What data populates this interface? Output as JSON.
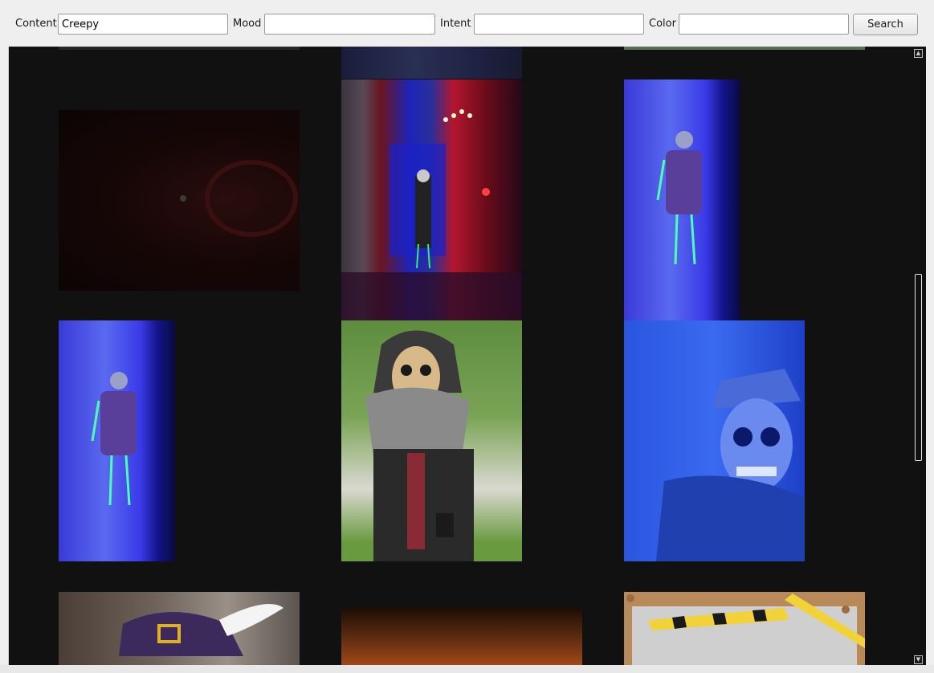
{
  "filters": {
    "content_label": "Content",
    "content_value": "Creepy",
    "mood_label": "Mood",
    "mood_value": "",
    "intent_label": "Intent",
    "intent_value": "",
    "color_label": "Color",
    "color_value": "",
    "search_label": "Search"
  },
  "results": {
    "images": [
      {
        "name": "partial-dark-image"
      },
      {
        "name": "partial-blue-image"
      },
      {
        "name": "partial-green-image"
      },
      {
        "name": "dark-red-room-image"
      },
      {
        "name": "red-doorway-skeleton-image"
      },
      {
        "name": "blue-skeleton-doorway-image"
      },
      {
        "name": "blue-skeleton-doorway-image-2"
      },
      {
        "name": "hooded-skull-costume-image"
      },
      {
        "name": "blue-skull-mask-image"
      },
      {
        "name": "cartoon-hat-image"
      },
      {
        "name": "dark-orange-forest-image"
      },
      {
        "name": "cartoon-caution-tape-image"
      }
    ]
  },
  "icons": {
    "scroll_up": "arrow-up-icon",
    "scroll_down": "arrow-down-icon"
  },
  "colors": {
    "toolbar_bg": "#efefef",
    "results_bg": "#111111"
  }
}
